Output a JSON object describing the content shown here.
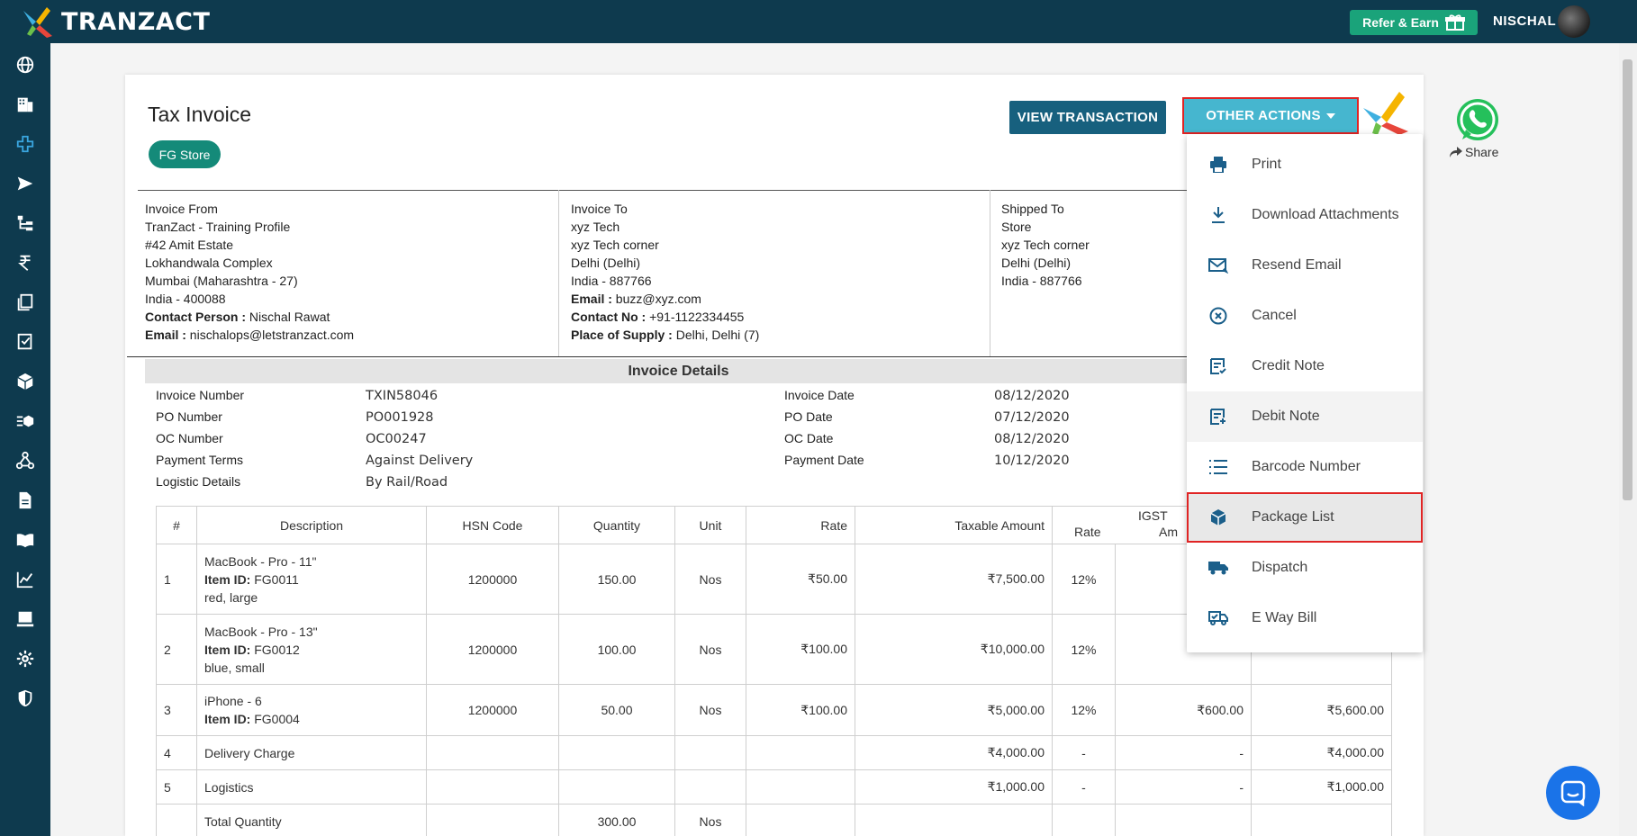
{
  "app": {
    "brand": "TRANZACT"
  },
  "topbar": {
    "refer_label": "Refer & Earn",
    "user_name": "NISCHAL"
  },
  "sidebar": {
    "items": [
      {
        "icon": "globe-icon"
      },
      {
        "icon": "building-icon"
      },
      {
        "icon": "plus-cross-icon"
      },
      {
        "icon": "send-icon"
      },
      {
        "icon": "hierarchy-icon"
      },
      {
        "icon": "rupee-icon"
      },
      {
        "icon": "documents-icon"
      },
      {
        "icon": "checklist-icon"
      },
      {
        "icon": "box-icon"
      },
      {
        "icon": "box-list-icon"
      },
      {
        "icon": "network-icon"
      },
      {
        "icon": "file-icon"
      },
      {
        "icon": "book-icon"
      },
      {
        "icon": "chart-icon"
      },
      {
        "icon": "terminal-icon"
      },
      {
        "icon": "gear-icon"
      },
      {
        "icon": "shield-icon"
      }
    ]
  },
  "page": {
    "title": "Tax Invoice",
    "store_badge": "FG Store",
    "view_transaction": "VIEW TRANSACTION",
    "other_actions": "OTHER ACTIONS",
    "share": "Share"
  },
  "invoice_from": {
    "heading": "Invoice From",
    "name": "TranZact - Training Profile",
    "line1": "#42 Amit Estate",
    "line2": "Lokhandwala Complex",
    "line3": "Mumbai (Maharashtra - 27)",
    "line4": "India - 400088",
    "contact_label": "Contact Person :",
    "contact_value": " Nischal Rawat",
    "email_label": "Email :",
    "email_value": " nischalops@letstranzact.com"
  },
  "invoice_to": {
    "heading": "Invoice To",
    "name": "xyz Tech",
    "line1": "xyz Tech corner",
    "line2": "Delhi (Delhi)",
    "line3": "India - 887766",
    "email_label": "Email :",
    "email_value": " buzz@xyz.com",
    "contact_label": "Contact No :",
    "contact_value": " +91-1122334455",
    "pos_label": "Place of Supply :",
    "pos_value": " Delhi, Delhi (7)"
  },
  "shipped_to": {
    "heading": "Shipped To",
    "name": "Store",
    "line1": "xyz Tech corner",
    "line2": "Delhi (Delhi)",
    "line3": "India - 887766"
  },
  "details": {
    "heading": "Invoice Details",
    "left": [
      {
        "label": "Invoice Number",
        "value": "TXIN58046"
      },
      {
        "label": "PO Number",
        "value": "PO001928"
      },
      {
        "label": "OC Number",
        "value": "OC00247"
      },
      {
        "label": "Payment Terms",
        "value": "Against Delivery"
      },
      {
        "label": "Logistic Details",
        "value": "By Rail/Road"
      }
    ],
    "right": [
      {
        "label": "Invoice Date",
        "value": "08/12/2020"
      },
      {
        "label": "PO Date",
        "value": "07/12/2020"
      },
      {
        "label": "OC Date",
        "value": "08/12/2020"
      },
      {
        "label": "Payment Date",
        "value": "10/12/2020"
      }
    ]
  },
  "table": {
    "headers": {
      "num": "#",
      "desc": "Description",
      "hsn": "HSN Code",
      "qty": "Quantity",
      "unit": "Unit",
      "rate": "Rate",
      "taxable": "Taxable Amount",
      "igst": "IGST",
      "igst_rate": "Rate",
      "igst_amount": "Am"
    },
    "rows": [
      {
        "num": "1",
        "desc1": "MacBook - Pro - 11\"",
        "item_label": "Item ID:",
        "item_id": " FG0011",
        "desc3": "red, large",
        "hsn": "1200000",
        "qty": "150.00",
        "unit": "Nos",
        "rate": "₹50.00",
        "taxable": "₹7,500.00",
        "igst_rate": "12%",
        "igst_amount": "",
        "total": ""
      },
      {
        "num": "2",
        "desc1": "MacBook - Pro - 13\"",
        "item_label": "Item ID:",
        "item_id": " FG0012",
        "desc3": "blue, small",
        "hsn": "1200000",
        "qty": "100.00",
        "unit": "Nos",
        "rate": "₹100.00",
        "taxable": "₹10,000.00",
        "igst_rate": "12%",
        "igst_amount": "",
        "total": ""
      },
      {
        "num": "3",
        "desc1": "iPhone - 6",
        "item_label": "Item ID:",
        "item_id": " FG0004",
        "desc3": "",
        "hsn": "1200000",
        "qty": "50.00",
        "unit": "Nos",
        "rate": "₹100.00",
        "taxable": "₹5,000.00",
        "igst_rate": "12%",
        "igst_amount": "₹600.00",
        "total": "₹5,600.00"
      },
      {
        "num": "4",
        "desc1": "Delivery Charge",
        "taxable": "₹4,000.00",
        "igst_rate": "-",
        "igst_amount": "-",
        "total": "₹4,000.00"
      },
      {
        "num": "5",
        "desc1": "Logistics",
        "taxable": "₹1,000.00",
        "igst_rate": "-",
        "igst_amount": "-",
        "total": "₹1,000.00"
      }
    ],
    "total_row": {
      "label": "Total Quantity",
      "qty": "300.00",
      "unit": "Nos"
    }
  },
  "dropdown": {
    "items": [
      {
        "label": "Print",
        "icon": "printer-icon"
      },
      {
        "label": "Download Attachments",
        "icon": "download-icon"
      },
      {
        "label": "Resend Email",
        "icon": "email-icon"
      },
      {
        "label": "Cancel",
        "icon": "cancel-circle-icon"
      },
      {
        "label": "Credit Note",
        "icon": "credit-note-icon"
      },
      {
        "label": "Debit Note",
        "icon": "debit-note-icon"
      },
      {
        "label": "Barcode Number",
        "icon": "list-icon"
      },
      {
        "label": "Package List",
        "icon": "package-icon"
      },
      {
        "label": "Dispatch",
        "icon": "truck-icon"
      },
      {
        "label": "E Way Bill",
        "icon": "eway-truck-icon"
      }
    ]
  },
  "colors": {
    "topbar": "#0e3a4e",
    "accent_teal": "#46b6cf",
    "view_btn": "#17607e",
    "refer_green": "#1aa37a",
    "highlight_red": "#e02424",
    "icon_blue": "#1b5f8a"
  }
}
